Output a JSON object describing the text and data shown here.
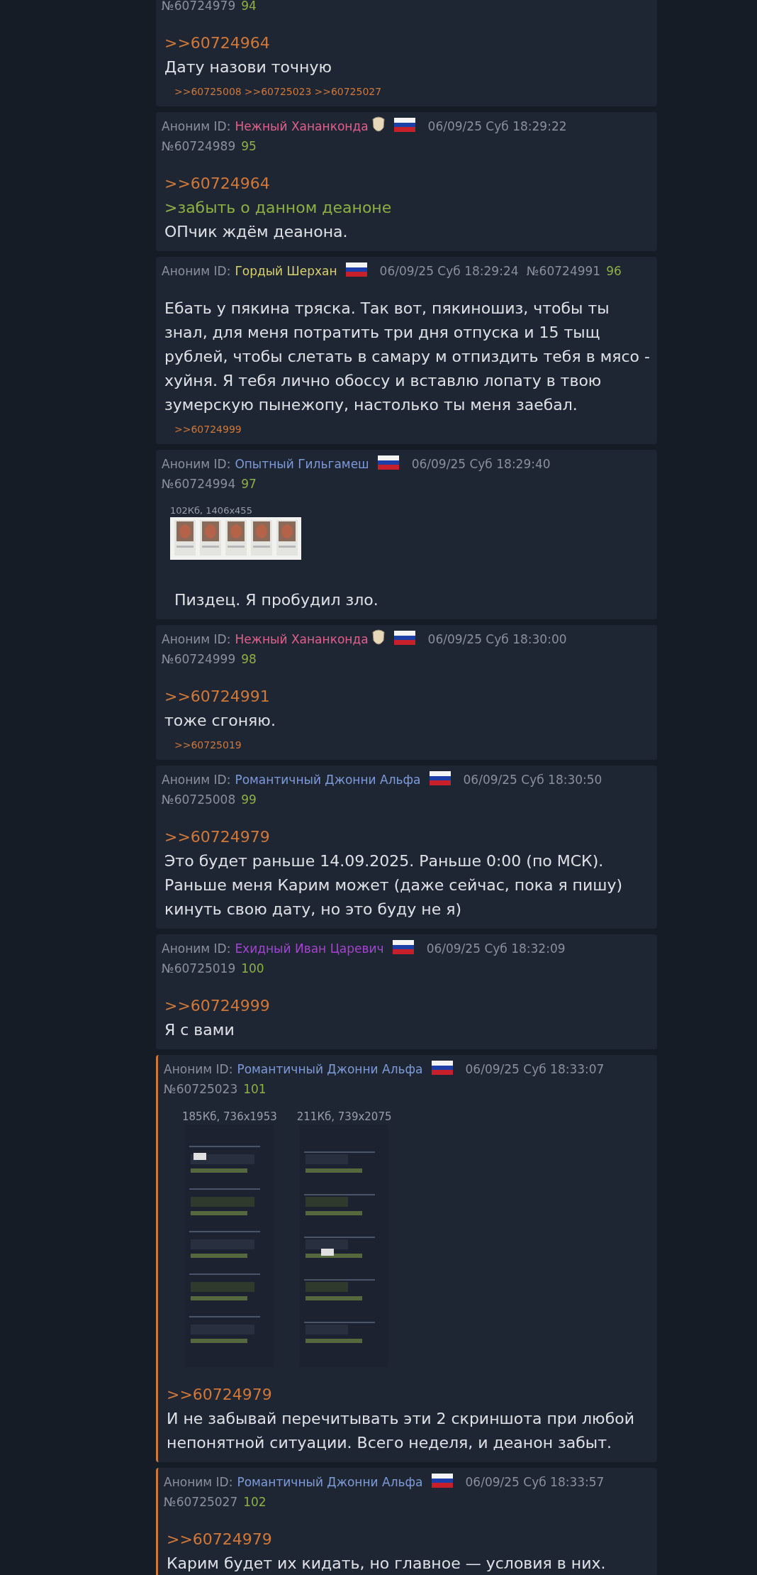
{
  "posts": [
    {
      "highlighted": false,
      "number": "№60724979",
      "index": "94",
      "body": [
        {
          "kind": "reply",
          "text": ">>60724964"
        },
        {
          "kind": "text",
          "text": "Дату назови точную"
        }
      ],
      "replies": [
        ">>60725008",
        ">>60725023",
        ">>60725027"
      ]
    },
    {
      "highlighted": false,
      "author": {
        "prefix": "Аноним ID:",
        "name": "Нежный Хананконда",
        "color": "#e0608c",
        "mask": true
      },
      "date": "06/09/25 Суб 18:29:22",
      "number": "№60724989",
      "index": "95",
      "body": [
        {
          "kind": "reply",
          "text": ">>60724964"
        },
        {
          "kind": "quote",
          "text": ">забыть о данном деаноне"
        },
        {
          "kind": "text",
          "text": "ОПчик ждём деанона."
        }
      ]
    },
    {
      "highlighted": false,
      "author": {
        "prefix": "Аноним ID:",
        "name": "Гордый Шерхан",
        "color": "#d8cf6e"
      },
      "date": "06/09/25 Суб 18:29:24",
      "number": "№60724991",
      "index": "96",
      "body": [
        {
          "kind": "text",
          "text": "Ебать у пякина тряска. Так вот, пякиношиз, чтобы ты знал, для меня потратить три дня отпуска и 15 тыщ рублей, чтобы слетать в самару м отпиздить тебя в мясо - хуйня. Я тебя лично обоссу и вставлю лопату в твою зумерскую пынежопу, настолько ты меня заебал."
        }
      ],
      "replies": [
        ">>60724999"
      ]
    },
    {
      "highlighted": false,
      "author": {
        "prefix": "Аноним ID:",
        "name": "Опытный Гильгамеш",
        "color": "#7d9bd8"
      },
      "date": "06/09/25 Суб 18:29:40",
      "number": "№60724994",
      "index": "97",
      "images": [
        {
          "info": "102Кб, 1406x455",
          "kind": "picture"
        }
      ],
      "body": [
        {
          "kind": "text",
          "text": "Пиздец. Я пробудил зло."
        }
      ]
    },
    {
      "highlighted": false,
      "author": {
        "prefix": "Аноним ID:",
        "name": "Нежный Хананконда",
        "color": "#e0608c",
        "mask": true
      },
      "date": "06/09/25 Суб 18:30:00",
      "number": "№60724999",
      "index": "98",
      "body": [
        {
          "kind": "reply",
          "text": ">>60724991"
        },
        {
          "kind": "text",
          "text": "тоже сгоняю."
        }
      ],
      "replies": [
        ">>60725019"
      ]
    },
    {
      "highlighted": false,
      "author": {
        "prefix": "Аноним ID:",
        "name": "Романтичный Джонни Альфа",
        "color": "#7d9bd8"
      },
      "date": "06/09/25 Суб 18:30:50",
      "number": "№60725008",
      "index": "99",
      "body": [
        {
          "kind": "reply",
          "text": ">>60724979"
        },
        {
          "kind": "text",
          "text": "Это будет раньше 14.09.2025. Раньше 0:00 (по МСК). Раньше меня Карим может (даже сейчас, пока я пишу) кинуть свою дату, но это буду не я)"
        }
      ]
    },
    {
      "highlighted": false,
      "author": {
        "prefix": "Аноним ID:",
        "name": "Ехидный Иван Царевич",
        "color": "#a345cf"
      },
      "date": "06/09/25 Суб 18:32:09",
      "number": "№60725019",
      "index": "100",
      "body": [
        {
          "kind": "reply",
          "text": ">>60724999"
        },
        {
          "kind": "text",
          "text": "Я с вами"
        }
      ]
    },
    {
      "highlighted": true,
      "author": {
        "prefix": "Аноним ID:",
        "name": "Романтичный Джонни Альфа",
        "color": "#7d9bd8"
      },
      "date": "06/09/25 Суб 18:33:07",
      "number": "№60725023",
      "index": "101",
      "images": [
        {
          "info": "185Кб, 736x1953",
          "kind": "picture"
        },
        {
          "info": "211Кб, 739x2075",
          "kind": "picture"
        }
      ],
      "body": [
        {
          "kind": "reply",
          "text": ">>60724979"
        },
        {
          "kind": "text",
          "text": "И не забывай перечитывать эти 2 скриншота при любой непонятной ситуации. Всего неделя, и деанон забыт."
        }
      ]
    },
    {
      "highlighted": true,
      "author": {
        "prefix": "Аноним ID:",
        "name": "Романтичный Джонни Альфа",
        "color": "#7d9bd8"
      },
      "date": "06/09/25 Суб 18:33:57",
      "number": "№60725027",
      "index": "102",
      "body": [
        {
          "kind": "reply",
          "text": ">>60724979"
        },
        {
          "kind": "text",
          "text": "Карим будет их кидать, но главное — условия в них."
        }
      ]
    }
  ]
}
